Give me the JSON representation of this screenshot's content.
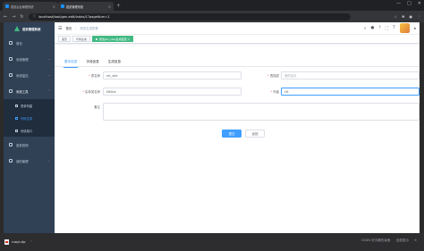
{
  "browser": {
    "tabs": [
      {
        "title": "若依后台管理系统"
      },
      {
        "title": "若依管理系统"
      }
    ],
    "new_tab_symbol": "+",
    "url": "localhost/tool/gen-edit/index/1?pageNum=1",
    "window_controls": [
      "—",
      "□",
      "✕"
    ]
  },
  "sidebar": {
    "brand": "若依管理系统",
    "items": [
      {
        "label": "首页",
        "icon": "dashboard-icon"
      },
      {
        "label": "系统管理",
        "icon": "settings-icon",
        "caret": "⌄"
      },
      {
        "label": "系统监控",
        "icon": "monitor-icon",
        "caret": "⌄"
      },
      {
        "label": "系统工具",
        "icon": "tool-icon",
        "caret": "⌃"
      }
    ],
    "sub_items": [
      {
        "label": "表单构建",
        "icon": "form-icon"
      },
      {
        "label": "代码生成",
        "icon": "code-icon"
      },
      {
        "label": "系统接口",
        "icon": "api-icon"
      }
    ],
    "bottom_items": [
      {
        "label": "若依官网",
        "icon": "send-icon"
      },
      {
        "label": "我的管理",
        "icon": "user-icon",
        "caret": "⌄"
      }
    ]
  },
  "navbar": {
    "hamburger": "☰",
    "breadcrumb": [
      "首页",
      "修改生成配置"
    ],
    "breadcrumb_sep": "/"
  },
  "tagsview": {
    "tags": [
      "首页",
      "代码生成"
    ],
    "active_tag": "修改[bs_site]生成配置 ×"
  },
  "tabs": {
    "items": [
      "基本信息",
      "字段信息",
      "生成信息"
    ]
  },
  "form": {
    "table_name_label": "表名称",
    "table_name_value": "mt_site",
    "table_desc_label": "表描述",
    "table_desc_placeholder": "我的站点",
    "entity_label": "实体类名称",
    "entity_value": "MtSite",
    "author_label": "作者",
    "author_value": "ctt",
    "remark_label": "备注",
    "required_mark": "*"
  },
  "buttons": {
    "submit": "提交",
    "back": "返回"
  },
  "downloads": {
    "file": "ruoyi.zip",
    "caret": "⌃",
    "watermark": "CSDN @沉睡的呆鱼",
    "show_all": "全部显示"
  }
}
